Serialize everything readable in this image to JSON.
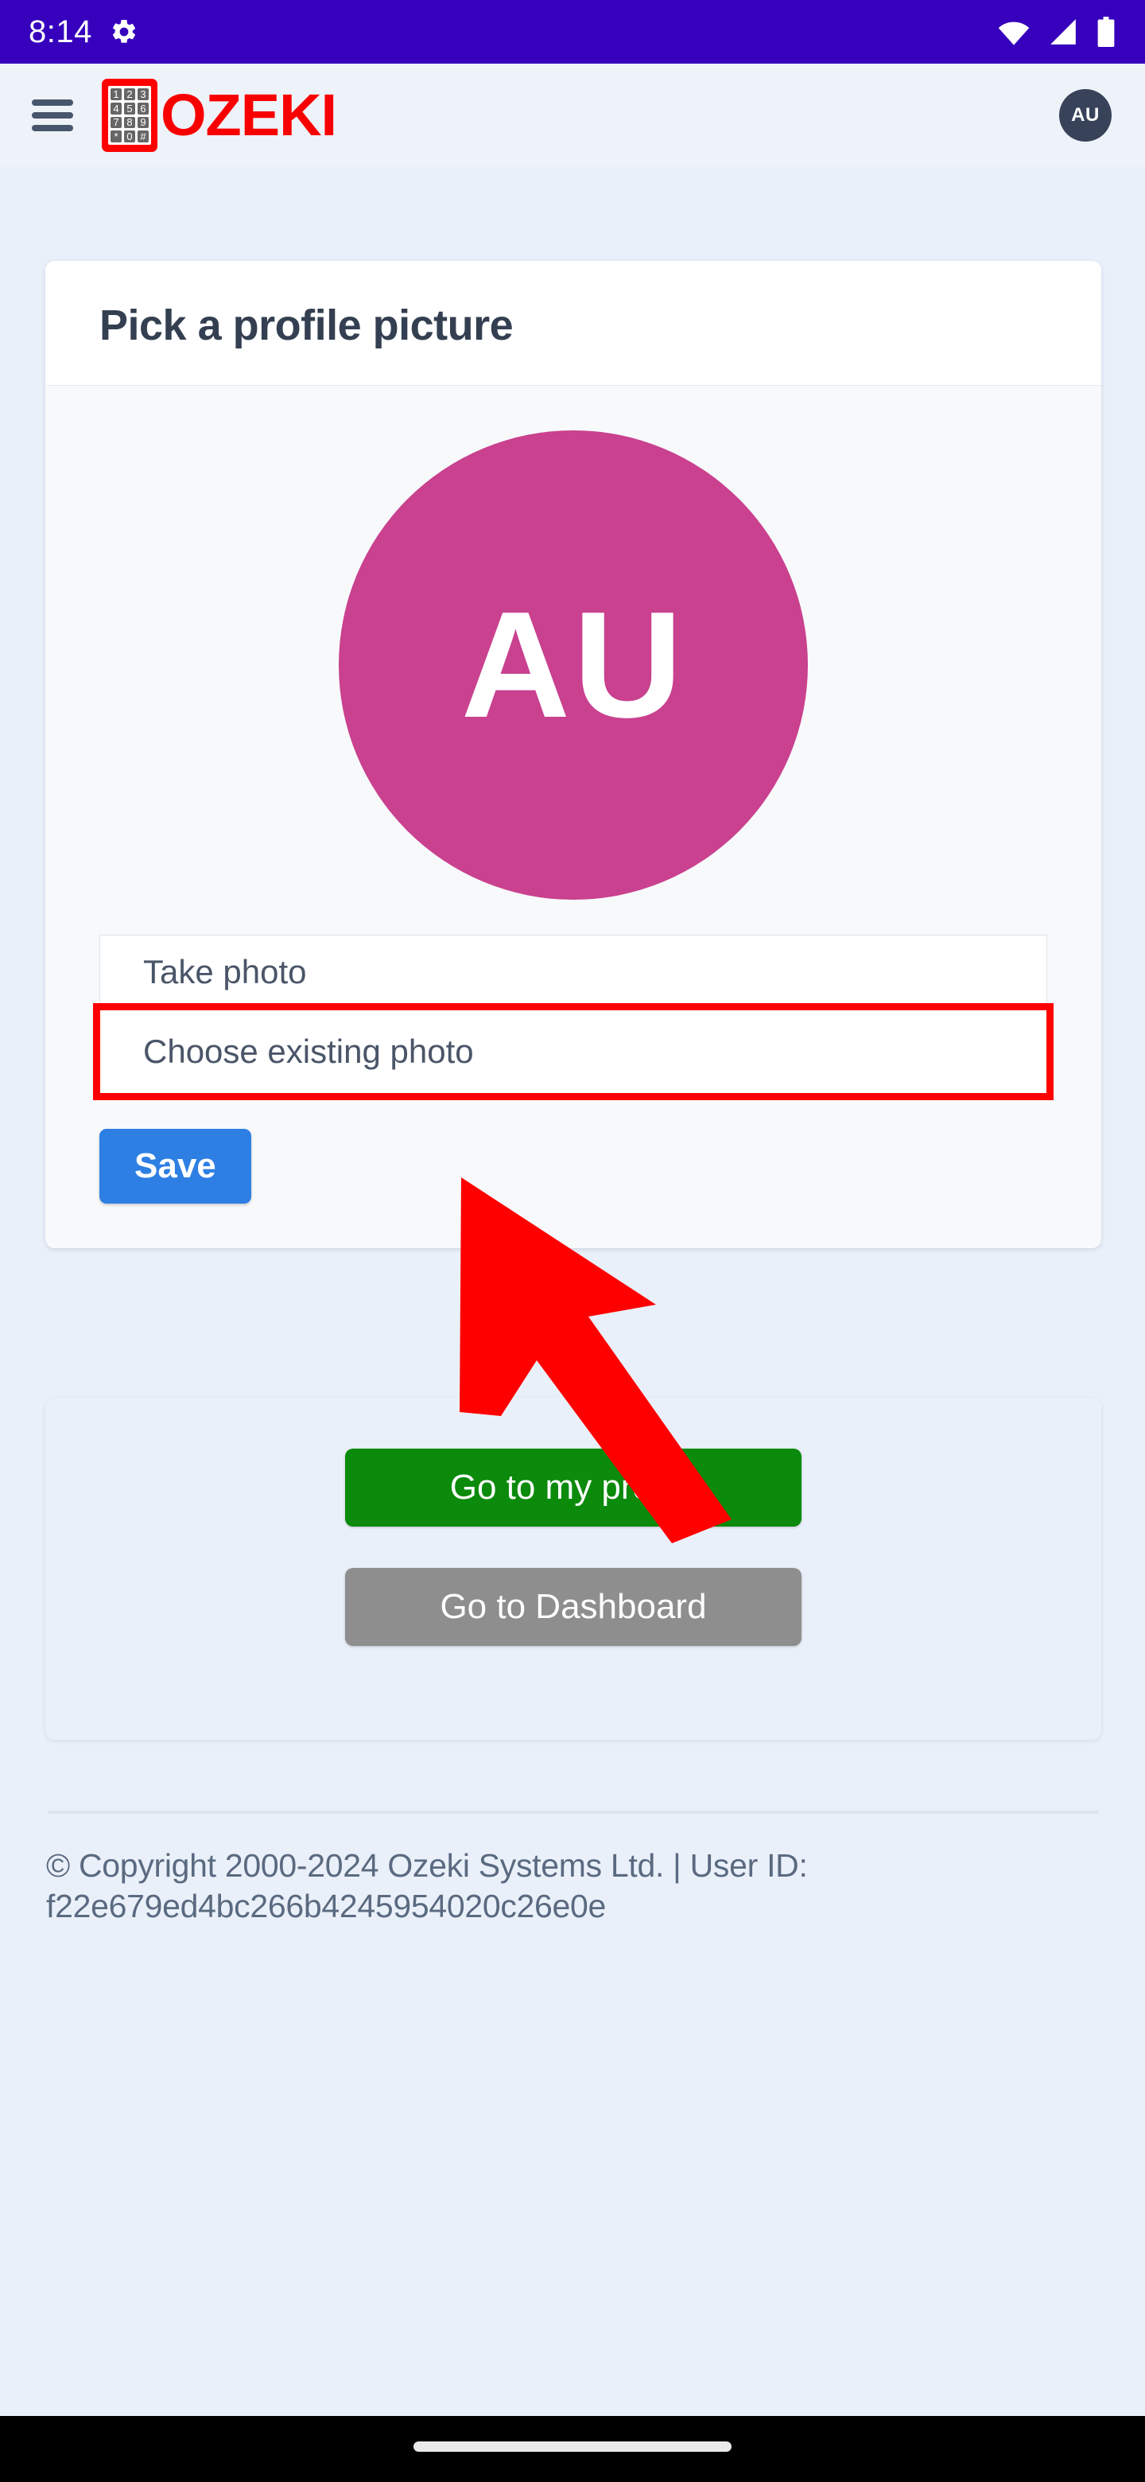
{
  "status_bar": {
    "time": "8:14",
    "icons": [
      "gear-icon",
      "wifi-icon",
      "signal-icon",
      "battery-icon"
    ],
    "background_color": "#3600bd"
  },
  "header": {
    "menu_icon": "hamburger-menu-icon",
    "logo_text": "OZEKI",
    "logo_icon": "keypad-icon",
    "keypad_keys": [
      "1",
      "2",
      "3",
      "4",
      "5",
      "6",
      "7",
      "8",
      "9",
      "*",
      "0",
      "#"
    ],
    "avatar_initials": "AU",
    "avatar_color": "#38435a",
    "logo_color": "#f90000"
  },
  "main_card": {
    "title": "Pick a profile picture",
    "avatar_initials": "AU",
    "avatar_color": "#c9418f",
    "options": [
      {
        "label": "Take photo",
        "highlighted": false
      },
      {
        "label": "Choose existing photo",
        "highlighted": true
      }
    ],
    "save_label": "Save",
    "save_color": "#2e7fe3"
  },
  "nav_card": {
    "buttons": [
      {
        "label": "Go to my profile",
        "color": "#0b8a0b"
      },
      {
        "label": "Go to Dashboard",
        "color": "#8e8e8e"
      }
    ]
  },
  "footer": {
    "text": "© Copyright 2000-2024 Ozeki Systems Ltd. | User ID: f22e679ed4bc266b4245954020c26e0e"
  },
  "annotation": {
    "arrow_color": "#ff0000",
    "highlight_color": "#ff0000",
    "points_to": "Choose existing photo"
  }
}
